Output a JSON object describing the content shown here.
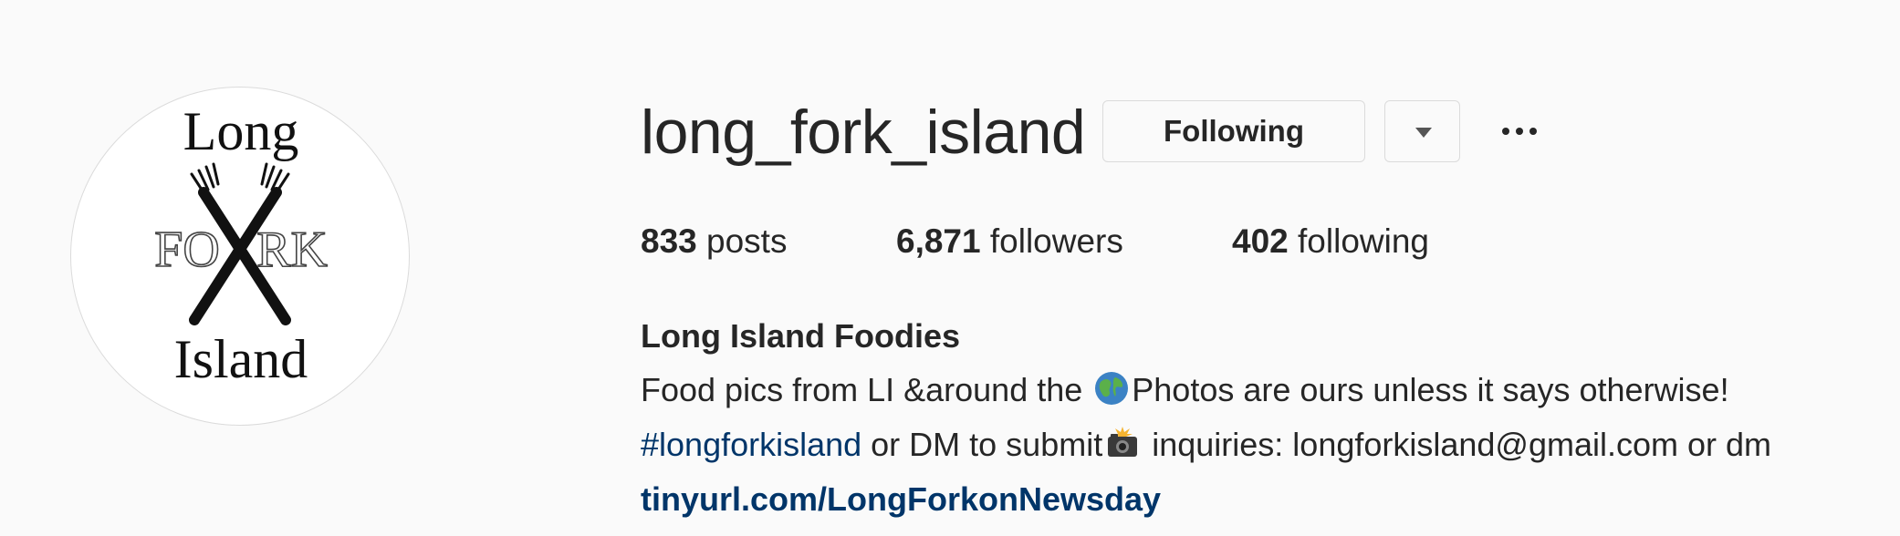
{
  "profile": {
    "username": "long_fork_island",
    "avatar_text": {
      "top": "Long",
      "left": "FO",
      "right": "RK",
      "bottom": "Island"
    }
  },
  "actions": {
    "following_label": "Following",
    "dropdown_icon": "chevron-down-icon",
    "more_icon": "more-options-icon"
  },
  "stats": {
    "posts_count": "833",
    "posts_label": "posts",
    "followers_count": "6,871",
    "followers_label": "followers",
    "following_count": "402",
    "following_label": "following"
  },
  "bio": {
    "full_name": "Long Island Foodies",
    "line1_before": "Food pics from LI &around the ",
    "line1_emoji": "globe-emoji",
    "line1_after": "Photos are ours unless it says otherwise!",
    "line2_hashtag": "#longforkisland",
    "line2_before": " or DM to submit",
    "line2_emoji": "camera-flash-emoji",
    "line2_after": " inquiries: longforkisland@gmail.com or dm",
    "link": "tinyurl.com/LongForkonNewsday"
  },
  "colors": {
    "background": "#fafafa",
    "text": "#262626",
    "link": "#003569",
    "border": "#dbdbdb"
  }
}
